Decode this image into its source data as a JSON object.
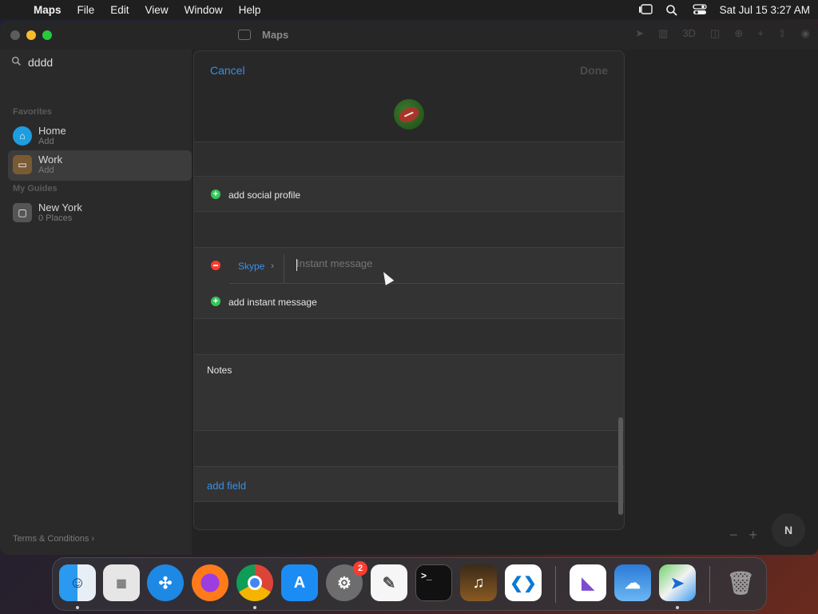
{
  "menubar": {
    "app": "Maps",
    "items": [
      "File",
      "Edit",
      "View",
      "Window",
      "Help"
    ],
    "clock": "Sat Jul 15  3:27 AM"
  },
  "window": {
    "title": "Maps",
    "toolbar_3d": "3D"
  },
  "sidebar": {
    "search_value": "dddd",
    "favorites_label": "Favorites",
    "favorites": [
      {
        "title": "Home",
        "subtitle": "Add",
        "icon": "house-icon",
        "color": "#1e9de0"
      },
      {
        "title": "Work",
        "subtitle": "Add",
        "icon": "briefcase-icon",
        "color": "#7a5a33"
      }
    ],
    "guides_label": "My Guides",
    "guides": [
      {
        "title": "New York",
        "subtitle": "0 Places",
        "icon": "guide-icon"
      }
    ],
    "terms": "Terms & Conditions"
  },
  "map": {
    "zoom_out": "−",
    "zoom_in": "+",
    "compass": "N"
  },
  "sheet": {
    "cancel": "Cancel",
    "done": "Done",
    "avatar_icon": "football-icon",
    "social_profile": "add social profile",
    "im_service": "Skype",
    "im_placeholder": "Instant message",
    "add_im": "add instant message",
    "notes_label": "Notes",
    "add_field": "add field"
  },
  "dock": {
    "apps": [
      "Finder",
      "Launchpad",
      "Safari",
      "Firefox",
      "Chrome",
      "App Store",
      "System Settings",
      "TextEdit",
      "Terminal",
      "GarageBand",
      "Visual Studio Code",
      "Visual Studio",
      "Weather",
      "Maps",
      "Trash"
    ],
    "settings_badge": "2"
  },
  "colors": {
    "accent": "#3a8fe6",
    "add_green": "#34c759",
    "remove_red": "#ff3b30"
  }
}
